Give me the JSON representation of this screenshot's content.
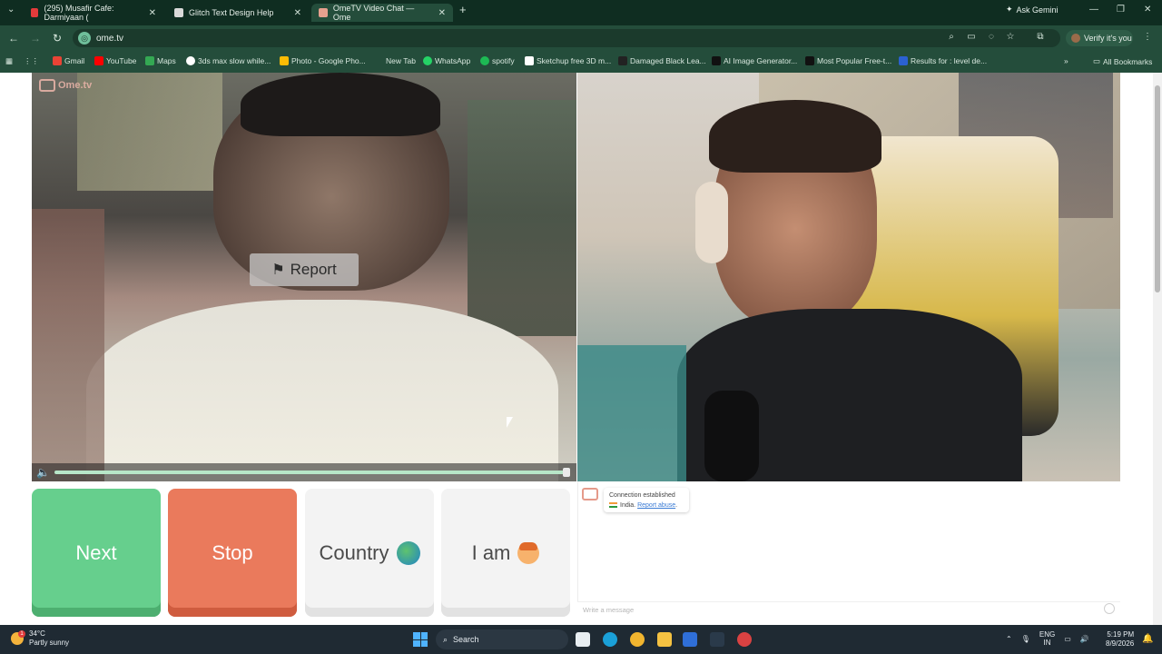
{
  "browser": {
    "tabs": [
      {
        "title": "(295) Musafir Cafe: Darmiyaan (",
        "favicon_color": "#e33b3b"
      },
      {
        "title": "Glitch Text Design Help",
        "favicon_color": "#d9d9d9"
      },
      {
        "title": "OmeTV Video Chat — Ome",
        "favicon_color": "#e6a08e"
      }
    ],
    "ask_gemini": "Ask Gemini",
    "url": "ome.tv",
    "profile_label": "Verify it's you",
    "bookmarks": [
      {
        "label": "Gmail",
        "color": "#ea4335"
      },
      {
        "label": "YouTube",
        "color": "#ff0000"
      },
      {
        "label": "Maps",
        "color": "#34a853"
      },
      {
        "label": "3ds max slow while...",
        "color": "#ffffff"
      },
      {
        "label": "Photo - Google Pho...",
        "color": "#fbbc05"
      },
      {
        "label": "New Tab",
        "color": ""
      },
      {
        "label": "WhatsApp",
        "color": "#25d366"
      },
      {
        "label": "spotify",
        "color": "#1db954"
      },
      {
        "label": "Sketchup free 3D m...",
        "color": "#ffffff"
      },
      {
        "label": "Damaged Black Lea...",
        "color": "#222222"
      },
      {
        "label": "AI Image Generator...",
        "color": "#111111"
      },
      {
        "label": "Most Popular Free-t...",
        "color": "#111111"
      },
      {
        "label": "Results for : level de...",
        "color": "#2b61d1"
      }
    ],
    "all_bookmarks": "All Bookmarks"
  },
  "ometv": {
    "logo_text": "Ome.tv",
    "report_label": "Report",
    "buttons": {
      "next": "Next",
      "stop": "Stop",
      "country": "Country",
      "iam": "I am"
    },
    "chat": {
      "status": "Connection established",
      "country": "India.",
      "report_abuse": "Report abuse",
      "input_placeholder": "Write a message"
    },
    "volume_level_percent": 100
  },
  "taskbar": {
    "weather_temp": "34°C",
    "weather_desc": "Partly sunny",
    "weather_badge": "1",
    "search_label": "Search",
    "lang_line1": "ENG",
    "lang_line2": "IN",
    "time": "5:19 PM",
    "date": "8/9/2026"
  }
}
